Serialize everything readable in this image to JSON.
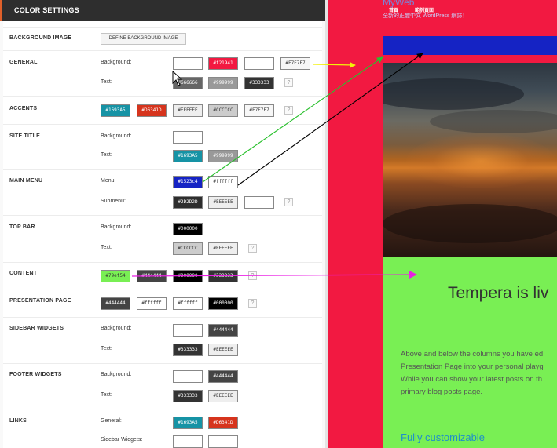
{
  "panel": {
    "title": "COLOR SETTINGS",
    "help_label": "?"
  },
  "sections": {
    "background_image": {
      "title": "BACKGROUND IMAGE",
      "button": "DEFINE BACKGROUND IMAGE"
    },
    "general": {
      "title": "GENERAL",
      "label1": "Background:",
      "label2": "Text:",
      "row1": [
        "",
        "#f21941",
        "",
        "#F7F7F7"
      ],
      "row2": [
        "#666666",
        "#999999",
        "#333333"
      ]
    },
    "accents": {
      "title": "ACCENTS",
      "row1": [
        "#1693A5",
        "#D6341D",
        "#EEEEEE",
        "#CCCCCC",
        "#F7F7F7"
      ]
    },
    "site_title": {
      "title": "SITE TITLE",
      "label1": "Background:",
      "label2": "Text:",
      "row1": [
        ""
      ],
      "row2": [
        "#1693A5",
        "#999999"
      ]
    },
    "main_menu": {
      "title": "MAIN MENU",
      "label1": "Menu:",
      "label2": "Submenu:",
      "row1": [
        "#1523c4",
        "#ffffff"
      ],
      "row2": [
        "#2D2D2D",
        "#EEEEEE",
        ""
      ]
    },
    "top_bar": {
      "title": "TOP BAR",
      "label1": "Background:",
      "label2": "Text:",
      "row1": [
        "#000000"
      ],
      "row2": [
        "#CCCCCC",
        "#EEEEEE"
      ]
    },
    "content": {
      "title": "CONTENT",
      "row1": [
        "#79ef54",
        "#444444",
        "#000000",
        "#333333"
      ]
    },
    "presentation_page": {
      "title": "PRESENTATION PAGE",
      "row1": [
        "#444444",
        "#ffffff",
        "#ffffff",
        "#000000"
      ]
    },
    "sidebar_widgets": {
      "title": "SIDEBAR WIDGETS",
      "label1": "Background:",
      "label2": "Text:",
      "row1": [
        "",
        "#444444"
      ],
      "row2": [
        "#333333",
        "#EEEEEE"
      ]
    },
    "footer_widgets": {
      "title": "FOOTER WIDGETS",
      "label1": "Background:",
      "label2": "Text:",
      "row1": [
        "",
        "#444444"
      ],
      "row2": [
        "#333333",
        "#EEEEEE"
      ]
    },
    "links": {
      "title": "LINKS",
      "label1": "General:",
      "label2": "Sidebar Widgets:",
      "row1": [
        "#1693A5",
        "#D6341D"
      ],
      "row2": [
        "",
        ""
      ]
    }
  },
  "preview": {
    "site_title": "MyWeb",
    "tagline": "全新的正體中文 WordPress 網誌！",
    "menu": [
      "首頁",
      "範例頁面"
    ],
    "content_heading": "Tempera is liv",
    "content_text": [
      "Above and below the columns you have ed",
      "Presentation Page into your personal playg",
      "While you can show your latest posts on th",
      "primary blog posts page."
    ],
    "content_subheading": "Fully customizable"
  },
  "colors": {
    "accent": "#e0602a",
    "header_bg": "#2e2e2e",
    "preview_bg": "#f21941",
    "menu_bg": "#1523c4",
    "content_bg": "#79ef54",
    "link": "#1f8fc9",
    "arrow_yellow": "#f2f20a",
    "arrow_green": "#29c02d",
    "arrow_black": "#000000",
    "arrow_magenta": "#ea1fe4"
  }
}
